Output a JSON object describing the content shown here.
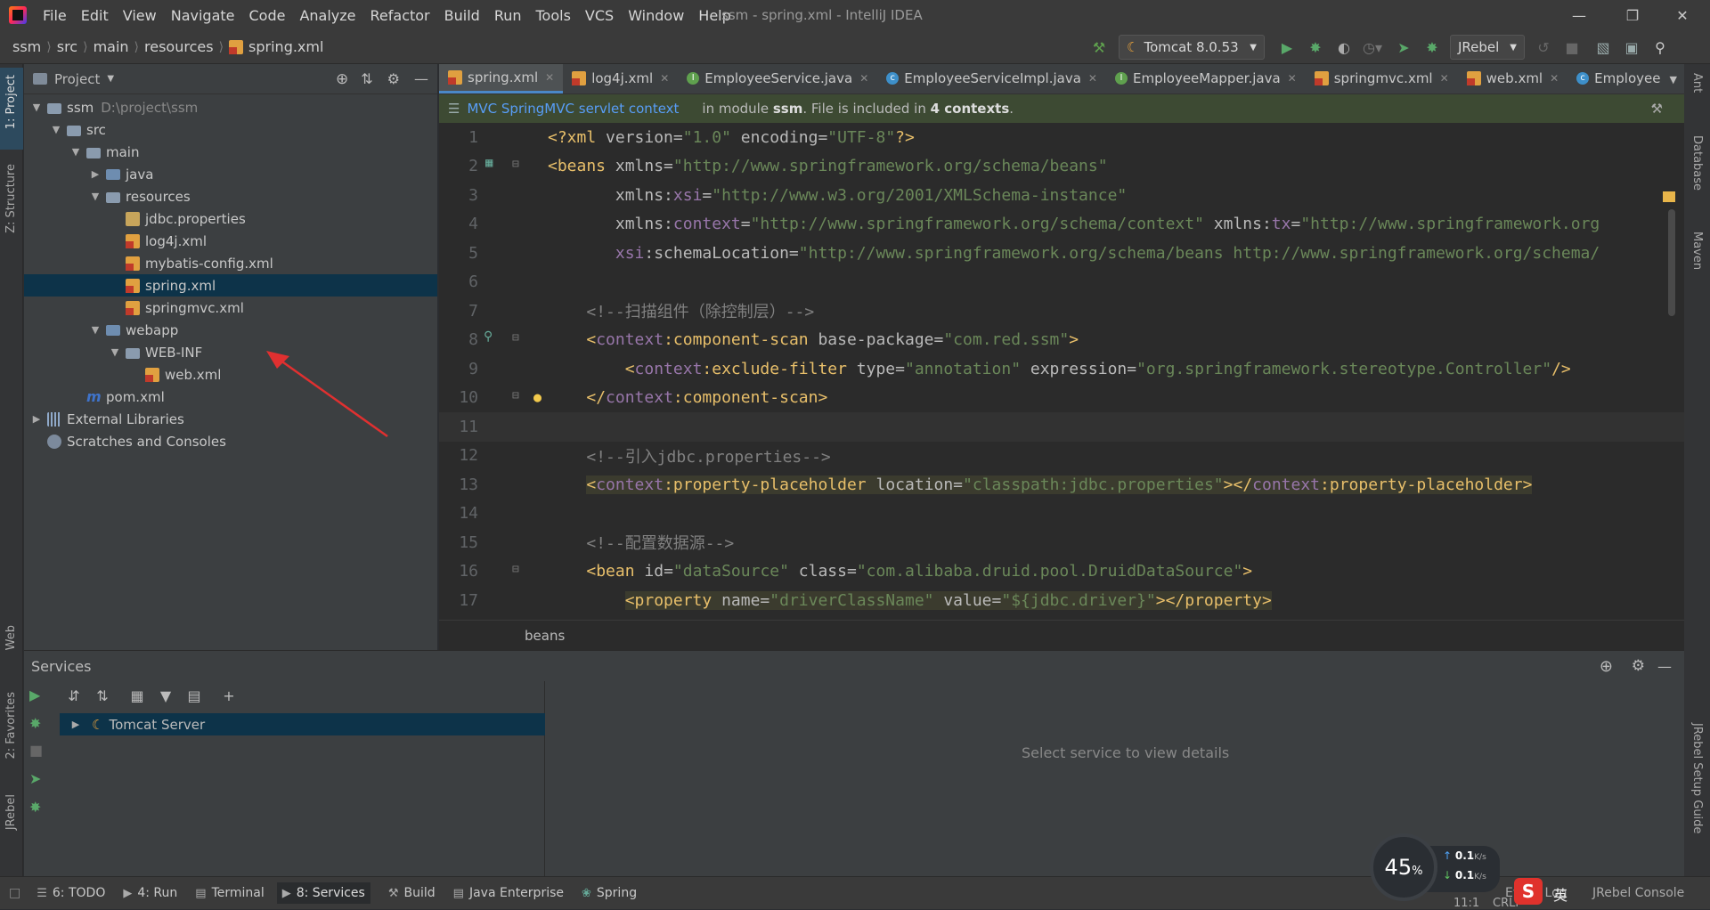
{
  "window": {
    "title": "ssm - spring.xml - IntelliJ IDEA",
    "menu": [
      "File",
      "Edit",
      "View",
      "Navigate",
      "Code",
      "Analyze",
      "Refactor",
      "Build",
      "Run",
      "Tools",
      "VCS",
      "Window",
      "Help"
    ]
  },
  "breadcrumb": [
    "ssm",
    "src",
    "main",
    "resources",
    "spring.xml"
  ],
  "toolbar": {
    "run_config": "Tomcat 8.0.53",
    "jrebel_combo": "JRebel"
  },
  "left_strip": {
    "project": "1: Project",
    "structure": "Z: Structure",
    "web": "Web",
    "favorites": "2: Favorites",
    "jrebel": "JRebel"
  },
  "right_strip": {
    "ant": "Ant",
    "database": "Database",
    "maven": "Maven",
    "jrebel_guide": "JRebel Setup Guide"
  },
  "project": {
    "title": "Project",
    "tree": [
      {
        "label": "ssm",
        "path": "D:\\project\\ssm",
        "level": 0,
        "open": true,
        "icon": "module-folder"
      },
      {
        "label": "src",
        "level": 1,
        "open": true,
        "icon": "folder"
      },
      {
        "label": "main",
        "level": 2,
        "open": true,
        "icon": "folder"
      },
      {
        "label": "java",
        "level": 3,
        "open": false,
        "icon": "source-folder"
      },
      {
        "label": "resources",
        "level": 3,
        "open": true,
        "icon": "resources-folder"
      },
      {
        "label": "jdbc.properties",
        "level": 4,
        "icon": "properties-file"
      },
      {
        "label": "log4j.xml",
        "level": 4,
        "icon": "xml-file"
      },
      {
        "label": "mybatis-config.xml",
        "level": 4,
        "icon": "xml-file"
      },
      {
        "label": "spring.xml",
        "level": 4,
        "icon": "xml-file",
        "selected": true
      },
      {
        "label": "springmvc.xml",
        "level": 4,
        "icon": "xml-file"
      },
      {
        "label": "webapp",
        "level": 3,
        "open": true,
        "icon": "web-folder"
      },
      {
        "label": "WEB-INF",
        "level": 4,
        "open": true,
        "icon": "folder"
      },
      {
        "label": "web.xml",
        "level": 5,
        "icon": "xml-file"
      },
      {
        "label": "pom.xml",
        "level": 2,
        "icon": "maven-file"
      },
      {
        "label": "External Libraries",
        "level": 0,
        "open": false,
        "icon": "library"
      },
      {
        "label": "Scratches and Consoles",
        "level": 0,
        "icon": "scratches"
      }
    ]
  },
  "tabs": [
    {
      "label": "spring.xml",
      "icon": "xml",
      "active": true
    },
    {
      "label": "log4j.xml",
      "icon": "xml"
    },
    {
      "label": "EmployeeService.java",
      "icon": "interface"
    },
    {
      "label": "EmployeeServiceImpl.java",
      "icon": "class"
    },
    {
      "label": "EmployeeMapper.java",
      "icon": "interface"
    },
    {
      "label": "springmvc.xml",
      "icon": "xml"
    },
    {
      "label": "web.xml",
      "icon": "xml"
    },
    {
      "label": "Employee",
      "icon": "class"
    }
  ],
  "infobar": {
    "link": "MVC SpringMVC servlet context",
    "text_pre": "in module ",
    "module": "ssm",
    "text_mid": ". File is included in ",
    "contexts": "4 contexts",
    "text_end": "."
  },
  "code_lines": [
    {
      "n": "1"
    },
    {
      "n": "2"
    },
    {
      "n": "3"
    },
    {
      "n": "4"
    },
    {
      "n": "5"
    },
    {
      "n": "6"
    },
    {
      "n": "7"
    },
    {
      "n": "8"
    },
    {
      "n": "9"
    },
    {
      "n": "10"
    },
    {
      "n": "11"
    },
    {
      "n": "12"
    },
    {
      "n": "13"
    },
    {
      "n": "14"
    },
    {
      "n": "15"
    },
    {
      "n": "16"
    },
    {
      "n": "17"
    }
  ],
  "code": {
    "l1": [
      "<?xml version=",
      "\"1.0\"",
      " encoding=",
      "\"UTF-8\"",
      "?>"
    ],
    "l2": [
      "<beans ",
      "xmlns=",
      "\"http://www.springframework.org/schema/beans\""
    ],
    "l3": [
      "xmlns:",
      "xsi",
      "=",
      "\"http://www.w3.org/2001/XMLSchema-instance\""
    ],
    "l4": [
      "xmlns:",
      "context",
      "=",
      "\"http://www.springframework.org/schema/context\"",
      " xmlns:",
      "tx",
      "=",
      "\"http://www.springframework.org"
    ],
    "l5": [
      "xsi",
      ":schemaLocation=",
      "\"http://www.springframework.org/schema/beans http://www.springframework.org/schema/"
    ],
    "l7": "<!--扫描组件（除控制层）-->",
    "l8": [
      "<",
      "context",
      ":component-scan ",
      "base-package=",
      "\"com.red.ssm\"",
      ">"
    ],
    "l9": [
      "<",
      "context",
      ":exclude-filter ",
      "type=",
      "\"annotation\"",
      " expression=",
      "\"org.springframework.stereotype.Controller\"",
      "/>"
    ],
    "l10": [
      "</",
      "context",
      ":component-scan>"
    ],
    "l12": "<!--引入jdbc.properties-->",
    "l13": [
      "<",
      "context",
      ":property-placeholder ",
      "location=",
      "\"classpath:jdbc.properties\"",
      "></",
      "context",
      ":property-placeholder>"
    ],
    "l15": "<!--配置数据源-->",
    "l16": [
      "<bean ",
      "id=",
      "\"dataSource\"",
      " class=",
      "\"com.alibaba.druid.pool.DruidDataSource\"",
      ">"
    ],
    "l17": [
      "<property ",
      "name=",
      "\"driverClassName\"",
      " value=",
      "\"${jdbc.driver}\"",
      "></property>"
    ]
  },
  "editor_crumb": "beans",
  "services": {
    "title": "Services",
    "item": "Tomcat Server",
    "detail": "Select service to view details"
  },
  "bottom_tabs": [
    "6: TODO",
    "4: Run",
    "Terminal",
    "8: Services",
    "Build",
    "Java Enterprise",
    "Spring"
  ],
  "bottom_right": {
    "event_log": "Event Log",
    "jrebel_console": "JRebel Console",
    "position": "11:1",
    "encoding": "CRLF"
  },
  "net_widget": {
    "percent": "45",
    "unit": "%",
    "up": "0.1",
    "down": "0.1",
    "rate_unit": "K/s"
  },
  "ime_overlay": "英"
}
